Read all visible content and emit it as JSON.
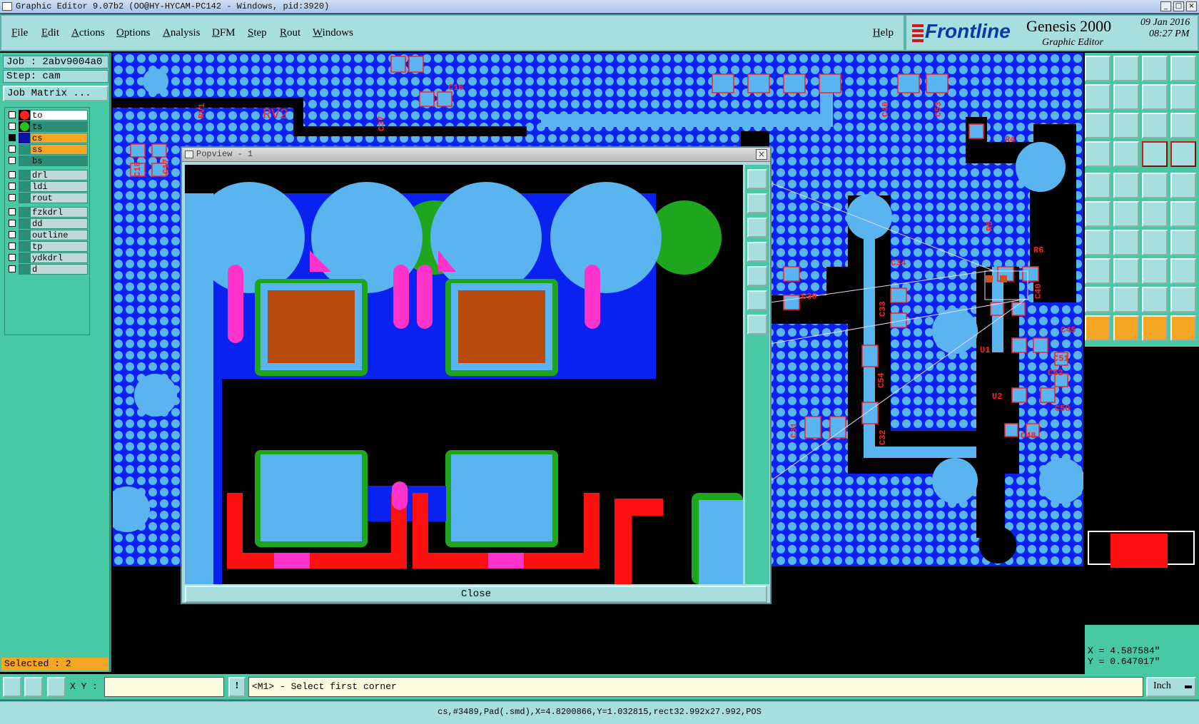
{
  "window": {
    "title": "Graphic Editor 9.07b2 (OO@HY-HYCAM-PC142 - Windows, pid:3920)"
  },
  "menu": {
    "items": [
      "File",
      "Edit",
      "Actions",
      "Options",
      "Analysis",
      "DFM",
      "Step",
      "Rout",
      "Windows"
    ],
    "help": "Help"
  },
  "brand": {
    "logo": "Frontline",
    "product": "Genesis 2000",
    "subtitle": "Graphic Editor",
    "date": "09 Jan 2016",
    "time": "08:27 PM"
  },
  "job": {
    "label": "Job : 2abv9004a0",
    "step": "Step: cam",
    "matrix_button": "Job Matrix ..."
  },
  "layers_board": [
    {
      "name": "to",
      "color": "#ff2020"
    },
    {
      "name": "ts",
      "color": "#22c022"
    },
    {
      "name": "cs",
      "color": "#f5a623"
    },
    {
      "name": "ss",
      "color": "#f5a623"
    },
    {
      "name": "bs",
      "color": "#2a8f76"
    }
  ],
  "layers_drill": [
    {
      "name": "drl"
    },
    {
      "name": "ldi"
    },
    {
      "name": "rout"
    }
  ],
  "layers_misc": [
    {
      "name": "fzkdrl"
    },
    {
      "name": "dd"
    },
    {
      "name": "outline"
    },
    {
      "name": "tp"
    },
    {
      "name": "ydkdrl"
    },
    {
      "name": "d"
    }
  ],
  "selected": "Selected : 2",
  "popview": {
    "title": "Popview - 1",
    "close_label": "Close"
  },
  "coords": {
    "x": "X = 4.587584\"",
    "y": "Y = 0.647017\""
  },
  "prompt": {
    "xy_label": "X Y :",
    "xy_value": "",
    "message": "<M1> - Select first corner",
    "units": "Inch"
  },
  "statusbar": "cs,#3489,Pad(.smd),X=4.8200866,Y=1.032815,rect32.992x27.992,POS",
  "board_labels": [
    "RV1",
    "RV2",
    "C18",
    "C17",
    "C16",
    "C37",
    "C40",
    "C53",
    "R4",
    "R5",
    "R6",
    "C34",
    "C30",
    "C33",
    "C40",
    "C54",
    "C31",
    "C32",
    "U2",
    "C45",
    "C51",
    "C52",
    "C50",
    "C48",
    "U1"
  ]
}
